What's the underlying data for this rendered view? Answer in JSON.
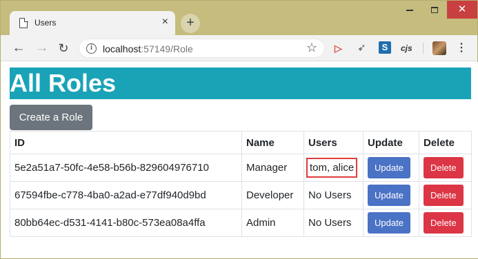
{
  "browser": {
    "tab_title": "Users",
    "tab_close": "×",
    "new_tab": "+",
    "url_host": "localhost",
    "url_path": ":57149/Role",
    "ext_s": "S",
    "ext_cjs": "cjs"
  },
  "page": {
    "heading": "All Roles",
    "create_button": "Create a Role",
    "table": {
      "headers": {
        "id": "ID",
        "name": "Name",
        "users": "Users",
        "update": "Update",
        "delete": "Delete"
      },
      "rows": [
        {
          "id": "5e2a51a7-50fc-4e58-b56b-829604976710",
          "name": "Manager",
          "users": "tom, alice",
          "update": "Update",
          "delete": "Delete",
          "highlighted": true
        },
        {
          "id": "67594fbe-c778-4ba0-a2ad-e77df940d9bd",
          "name": "Developer",
          "users": "No Users",
          "update": "Update",
          "delete": "Delete"
        },
        {
          "id": "80bb64ec-d531-4141-b80c-573ea08a4ffa",
          "name": "Admin",
          "users": "No Users",
          "update": "Update",
          "delete": "Delete"
        }
      ]
    }
  },
  "colors": {
    "heading_bg": "#1aa3b6",
    "create_button_bg": "#6c757d",
    "update_button_bg": "#4a72c5",
    "delete_button_bg": "#dc3545",
    "highlight_border": "#e03c3c"
  }
}
